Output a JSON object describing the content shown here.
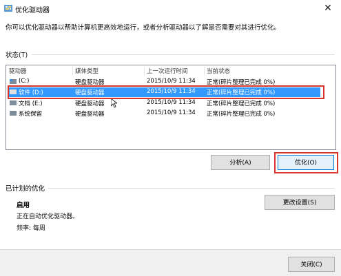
{
  "window": {
    "title": "优化驱动器"
  },
  "intro": "你可以优化驱动器以帮助计算机更高效地运行，或者分析驱动器以了解是否需要对其进行优化。",
  "status": {
    "label": "状态(T)",
    "columns": [
      "驱动器",
      "媒体类型",
      "上一次运行时间",
      "当前状态"
    ],
    "rows": [
      {
        "drive": "(C:)",
        "media": "硬盘驱动器",
        "last_run": "2015/10/9 11:34",
        "state": "正常(碎片整理已完成 0%)",
        "selected": false
      },
      {
        "drive": "软件 (D:)",
        "media": "硬盘驱动器",
        "last_run": "2015/10/9 11:34",
        "state": "正常(碎片整理已完成 0%)",
        "selected": true
      },
      {
        "drive": "文档 (E:)",
        "media": "硬盘驱动器",
        "last_run": "2015/10/9 11:34",
        "state": "正常(碎片整理已完成 0%)",
        "selected": false
      },
      {
        "drive": "系统保留",
        "media": "硬盘驱动器",
        "last_run": "2015/10/9 11:34",
        "state": "正常(碎片整理已完成 0%)",
        "selected": false
      }
    ]
  },
  "buttons": {
    "analyze": "分析(A)",
    "optimize": "优化(O)",
    "change_settings": "更改设置(S)",
    "close": "关闭(C)"
  },
  "scheduled": {
    "label": "已计划的优化",
    "state": "启用",
    "description": "正在自动优化驱动器。",
    "frequency": "频率: 每周"
  },
  "colors": {
    "selection": "#3399ff",
    "annotation_red": "#d9342b"
  }
}
